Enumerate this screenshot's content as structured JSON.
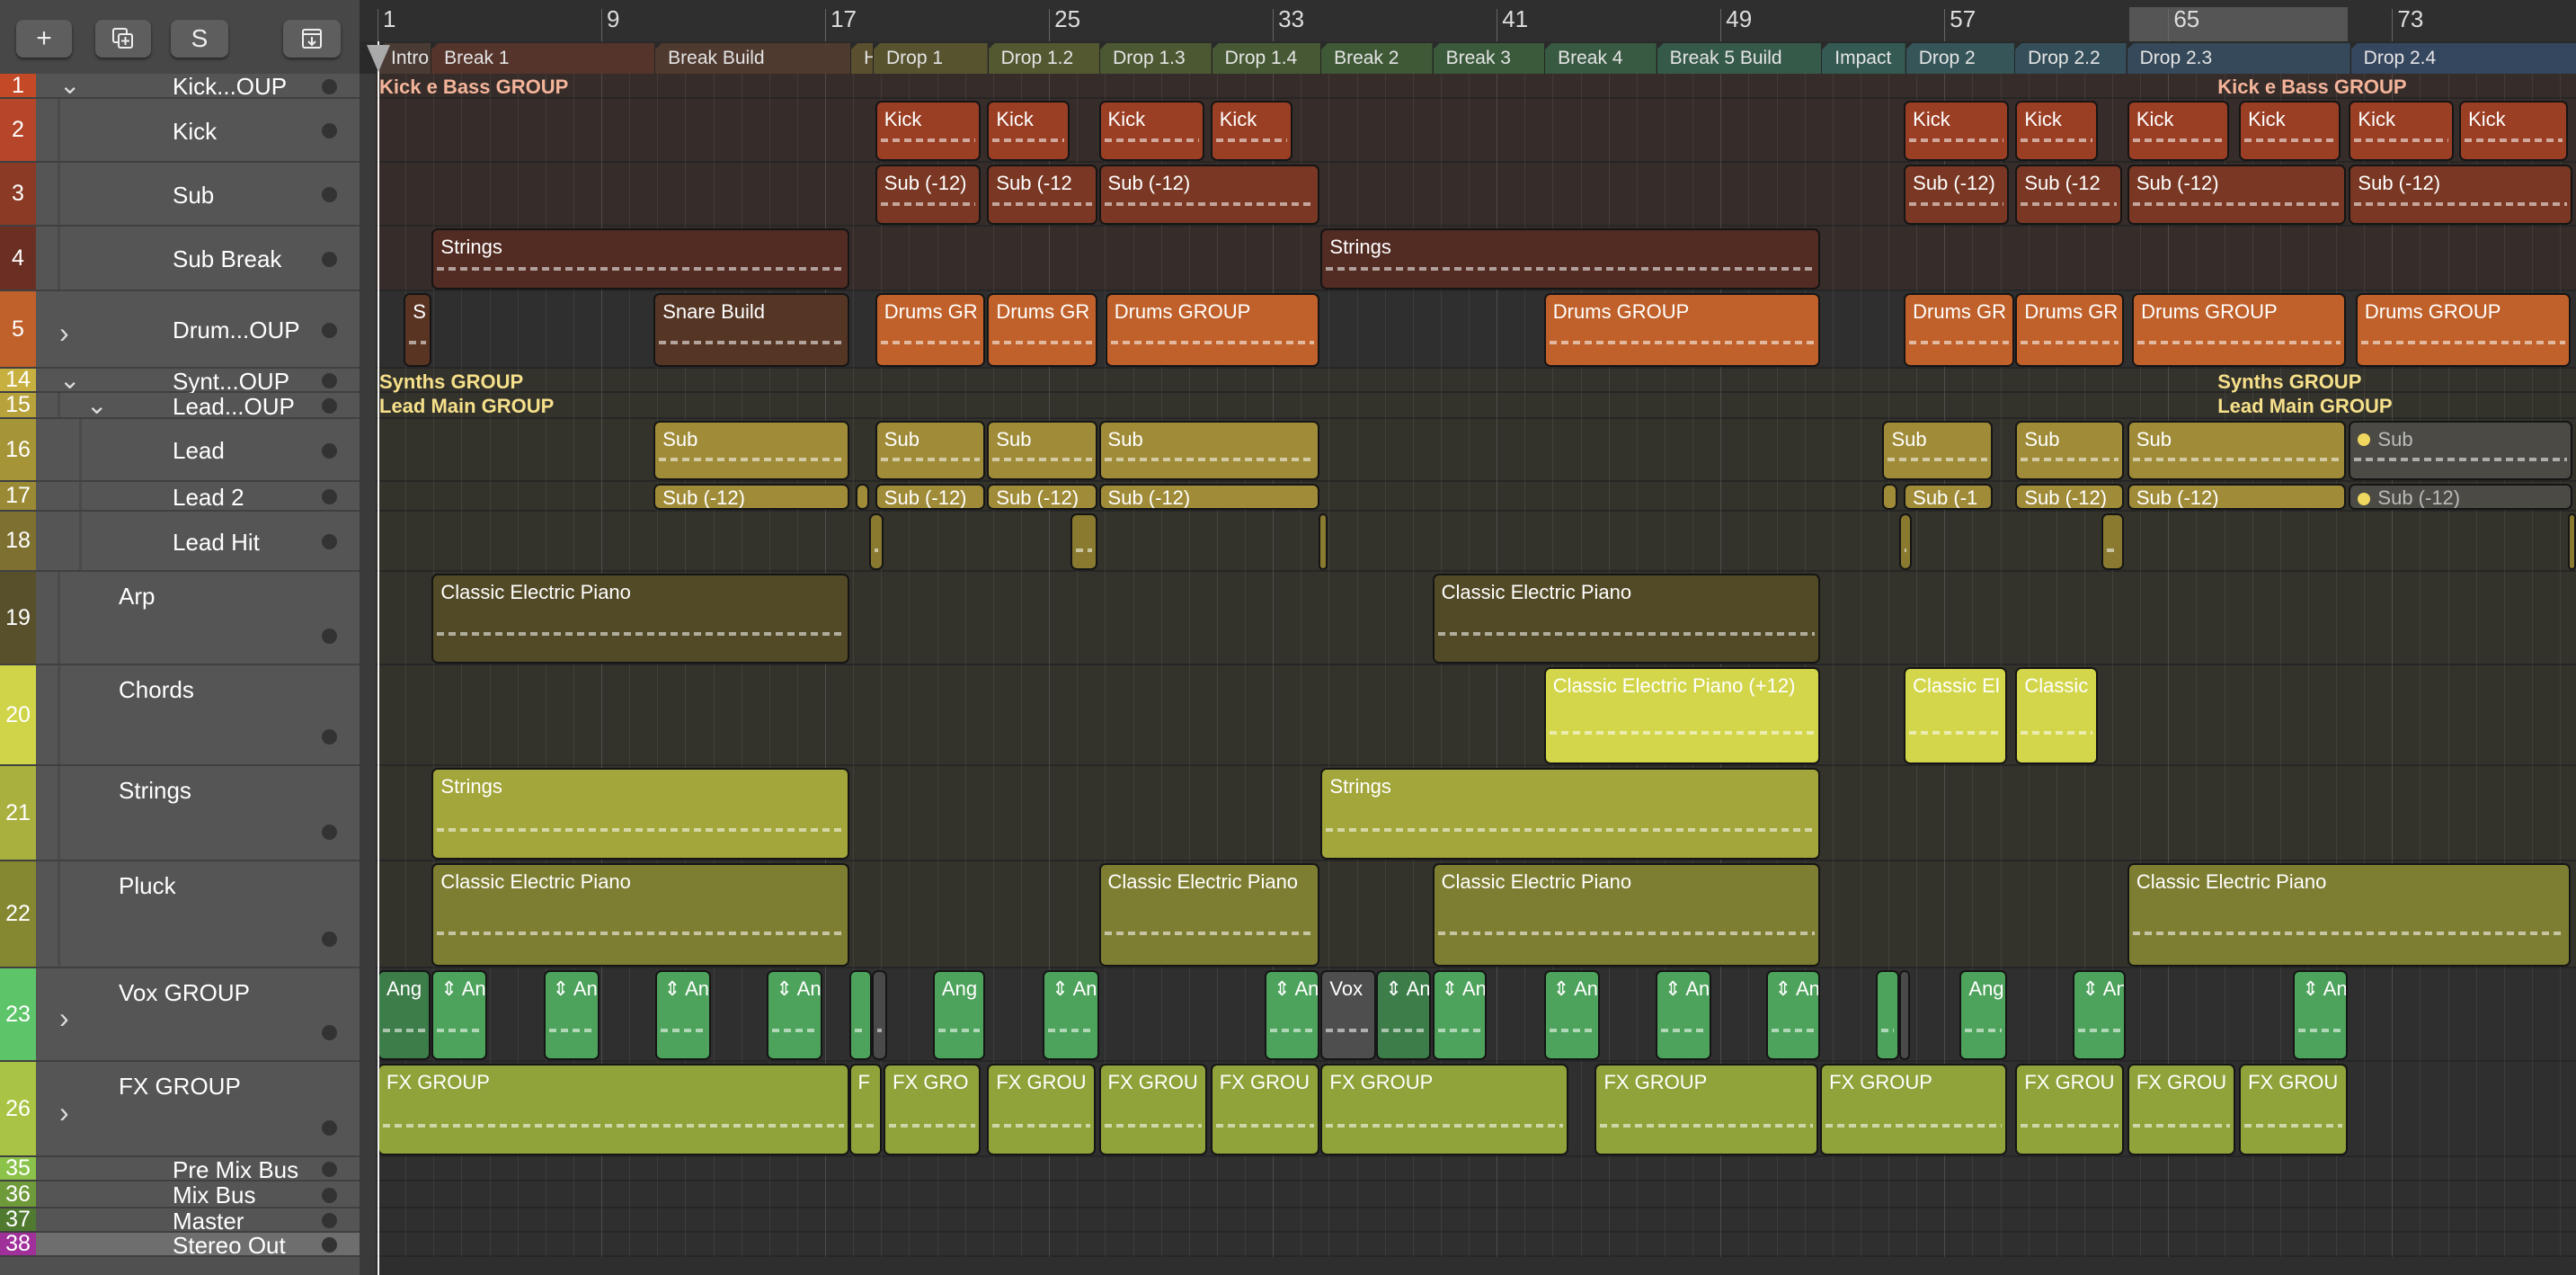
{
  "toolbar": {
    "add_label": "+",
    "duplicate_icon": "duplicate-track-icon",
    "s_label": "S",
    "download_icon": "download-icon"
  },
  "ruler": {
    "labels": [
      "1",
      "9",
      "17",
      "25",
      "33",
      "41",
      "49",
      "57",
      "65",
      "73"
    ],
    "bars": [
      1,
      9,
      17,
      25,
      33,
      41,
      49,
      57,
      65,
      73
    ],
    "cycle": {
      "start": 63.6,
      "end": 71.4
    }
  },
  "markers": [
    {
      "label": "Intro",
      "start": 1,
      "end": 2.9,
      "color": "#4a3b35"
    },
    {
      "label": "Break 1",
      "start": 2.9,
      "end": 10.9,
      "color": "#55342c"
    },
    {
      "label": "Break Build",
      "start": 10.9,
      "end": 17.9,
      "color": "#4f3a2f"
    },
    {
      "label": "H",
      "start": 17.9,
      "end": 18.7,
      "color": "#5a4f2e"
    },
    {
      "label": "Drop 1",
      "start": 18.7,
      "end": 22.8,
      "color": "#58532f"
    },
    {
      "label": "Drop 1.2",
      "start": 22.8,
      "end": 26.8,
      "color": "#535831"
    },
    {
      "label": "Drop 1.3",
      "start": 26.8,
      "end": 30.8,
      "color": "#4c5832"
    },
    {
      "label": "Drop 1.4",
      "start": 30.8,
      "end": 34.7,
      "color": "#465934"
    },
    {
      "label": "Break 2",
      "start": 34.7,
      "end": 38.7,
      "color": "#3f5936"
    },
    {
      "label": "Break 3",
      "start": 38.7,
      "end": 42.7,
      "color": "#3a5a3b"
    },
    {
      "label": "Break 4",
      "start": 42.7,
      "end": 46.7,
      "color": "#385a42"
    },
    {
      "label": "Break 5 Build",
      "start": 46.7,
      "end": 52.6,
      "color": "#365a4a"
    },
    {
      "label": "Impact",
      "start": 52.6,
      "end": 55.6,
      "color": "#355a53"
    },
    {
      "label": "Drop 2",
      "start": 55.6,
      "end": 59.5,
      "color": "#355559"
    },
    {
      "label": "Drop 2.2",
      "start": 59.5,
      "end": 63.5,
      "color": "#354f5a"
    },
    {
      "label": "Drop 2.3",
      "start": 63.5,
      "end": 71.5,
      "color": "#35495a"
    },
    {
      "label": "Drop 2.4",
      "start": 71.5,
      "end": 79.6,
      "color": "#35465f"
    }
  ],
  "tracks": [
    {
      "num": "1",
      "name": "Kick...OUP",
      "color": "#c44a27",
      "lane": "#362c29",
      "disclosure": "open",
      "group_label": "Kick e Bass GROUP",
      "group_color": "#f4b49a",
      "group_at": [
        1,
        66.7
      ],
      "regions": []
    },
    {
      "num": "2",
      "name": "Kick",
      "color": "#b5462a",
      "lane": "#362c29",
      "rcolor": "#9a3e24",
      "regions": [
        {
          "label": "Kick",
          "s": 18.79,
          "e": 22.55
        },
        {
          "label": "Kick",
          "s": 22.79,
          "e": 25.72
        },
        {
          "label": "Kick",
          "s": 26.78,
          "e": 30.54
        },
        {
          "label": "Kick",
          "s": 30.77,
          "e": 33.71
        },
        {
          "label": "Kick",
          "s": 55.55,
          "e": 59.31
        },
        {
          "label": "Kick",
          "s": 59.54,
          "e": 62.48
        },
        {
          "label": "Kick",
          "s": 63.54,
          "e": 67.18
        },
        {
          "label": "Kick",
          "s": 67.53,
          "e": 71.17
        },
        {
          "label": "Kick",
          "s": 71.46,
          "e": 75.22
        },
        {
          "label": "Kick",
          "s": 75.4,
          "e": 79.27
        }
      ]
    },
    {
      "num": "3",
      "name": "Sub",
      "color": "#8a3a25",
      "lane": "#362c29",
      "rcolor": "#7a3824",
      "regions": [
        {
          "label": "Sub (-12)",
          "s": 18.79,
          "e": 22.55
        },
        {
          "label": "Sub (-12",
          "s": 22.79,
          "e": 26.72
        },
        {
          "label": "Sub (-12)",
          "s": 26.78,
          "e": 34.65
        },
        {
          "label": "Sub (-12)",
          "s": 55.55,
          "e": 59.31
        },
        {
          "label": "Sub (-12",
          "s": 59.54,
          "e": 63.36
        },
        {
          "label": "Sub (-12)",
          "s": 63.54,
          "e": 71.35
        },
        {
          "label": "Sub (-12)",
          "s": 71.46,
          "e": 79.45
        }
      ]
    },
    {
      "num": "4",
      "name": "Sub Break",
      "color": "#6a2f22",
      "lane": "#362c29",
      "rcolor": "#522b22",
      "regions": [
        {
          "label": "Strings",
          "s": 2.94,
          "e": 17.85
        },
        {
          "label": "Strings",
          "s": 34.71,
          "e": 52.56
        }
      ]
    },
    {
      "num": "5",
      "name": "Drum...OUP",
      "color": "#c0612b",
      "lane": "#2f2f2f",
      "disclosure": "closed",
      "rcolor": "#c0612b",
      "regions": [
        {
          "label": "S",
          "s": 1.94,
          "e": 2.94,
          "c": "#5a3423"
        },
        {
          "label": "Snare Build",
          "s": 10.87,
          "e": 17.85,
          "c": "#553625"
        },
        {
          "label": "Drums GR",
          "s": 18.79,
          "e": 22.73
        },
        {
          "label": "Drums GR",
          "s": 22.79,
          "e": 26.72
        },
        {
          "label": "Drums GROUP",
          "s": 27.01,
          "e": 34.65
        },
        {
          "label": "Drums GROUP",
          "s": 42.69,
          "e": 52.56
        },
        {
          "label": "Drums GR",
          "s": 55.55,
          "e": 59.49
        },
        {
          "label": "Drums GR",
          "s": 59.54,
          "e": 63.42
        },
        {
          "label": "Drums GROUP",
          "s": 63.71,
          "e": 71.35
        },
        {
          "label": "Drums GROUP",
          "s": 71.7,
          "e": 79.39
        }
      ]
    },
    {
      "num": "14",
      "name": "Synt...OUP",
      "color": "#c8b040",
      "lane": "#33322b",
      "disclosure": "open",
      "group_label": "Synths GROUP",
      "group_color": "#f6e08a",
      "group_at": [
        1,
        66.7
      ],
      "regions": []
    },
    {
      "num": "15",
      "name": "Lead...OUP",
      "color": "#b8a23c",
      "lane": "#33322b",
      "disclosure": "open",
      "group_label": "Lead Main GROUP",
      "group_color": "#f6e08a",
      "group_at": [
        1,
        66.7
      ],
      "regions": []
    },
    {
      "num": "16",
      "name": "Lead",
      "color": "#a59537",
      "lane": "#33322b",
      "rcolor": "#a08c38",
      "regions": [
        {
          "label": "Sub",
          "s": 10.87,
          "e": 17.85
        },
        {
          "label": "Sub",
          "s": 18.79,
          "e": 22.73
        },
        {
          "label": "Sub",
          "s": 22.79,
          "e": 26.72
        },
        {
          "label": "Sub",
          "s": 26.78,
          "e": 34.65
        },
        {
          "label": "Sub",
          "s": 54.79,
          "e": 58.72
        },
        {
          "label": "Sub",
          "s": 59.54,
          "e": 63.42
        },
        {
          "label": "Sub",
          "s": 63.54,
          "e": 71.35
        },
        {
          "label": "Sub",
          "s": 71.46,
          "e": 79.45,
          "c": "#4b4a44",
          "muted": true
        }
      ]
    },
    {
      "num": "17",
      "name": "Lead 2",
      "color": "#9a8a35",
      "lane": "#33322b",
      "rcolor": "#a08c38",
      "regions": [
        {
          "label": "Sub (-12)",
          "s": 10.87,
          "e": 17.85
        },
        {
          "label": "",
          "s": 18.09,
          "e": 18.56
        },
        {
          "label": "Sub (-12)",
          "s": 18.79,
          "e": 22.73
        },
        {
          "label": "Sub (-12)",
          "s": 22.79,
          "e": 26.72
        },
        {
          "label": "Sub (-12)",
          "s": 26.78,
          "e": 34.65
        },
        {
          "label": "",
          "s": 54.79,
          "e": 55.32
        },
        {
          "label": "Sub (-1",
          "s": 55.55,
          "e": 58.72
        },
        {
          "label": "Sub (-12)",
          "s": 59.54,
          "e": 63.42
        },
        {
          "label": "Sub (-12)",
          "s": 63.54,
          "e": 71.35
        },
        {
          "label": "Sub (-12)",
          "s": 71.46,
          "e": 79.45,
          "c": "#4b4a44",
          "muted": true
        }
      ]
    },
    {
      "num": "18",
      "name": "Lead Hit",
      "color": "#7d7030",
      "lane": "#33322b",
      "rcolor": "#8a7a30",
      "regions": [
        {
          "label": "",
          "s": 18.56,
          "e": 19.09
        },
        {
          "label": "",
          "s": 25.78,
          "e": 26.72
        },
        {
          "label": "",
          "s": 34.63,
          "e": 34.94
        },
        {
          "label": "",
          "s": 55.38,
          "e": 55.84
        },
        {
          "label": "",
          "s": 62.6,
          "e": 63.42
        },
        {
          "label": "",
          "s": 79.27,
          "e": 79.57
        }
      ]
    },
    {
      "num": "19",
      "name": "Arp",
      "color": "#58502a",
      "lane": "#33322b",
      "big": true,
      "rcolor": "#524a26",
      "regions": [
        {
          "label": "Classic Electric Piano",
          "s": 2.94,
          "e": 17.85
        },
        {
          "label": "Classic Electric Piano",
          "s": 38.7,
          "e": 52.56
        }
      ]
    },
    {
      "num": "20",
      "name": "Chords",
      "color": "#cfd448",
      "lane": "#33322b",
      "big": true,
      "rcolor": "#d3d64a",
      "regions": [
        {
          "label": "Classic Electric Piano (+12)",
          "s": 42.69,
          "e": 52.56
        },
        {
          "label": "Classic El",
          "s": 55.55,
          "e": 59.25
        },
        {
          "label": "Classic",
          "s": 59.54,
          "e": 62.48
        }
      ]
    },
    {
      "num": "21",
      "name": "Strings",
      "color": "#aab03e",
      "lane": "#33322b",
      "big": true,
      "rcolor": "#a3a63a",
      "regions": [
        {
          "label": "Strings",
          "s": 2.94,
          "e": 17.85
        },
        {
          "label": "Strings",
          "s": 34.71,
          "e": 52.56
        }
      ]
    },
    {
      "num": "22",
      "name": "Pluck",
      "color": "#858830",
      "lane": "#33322b",
      "big": true,
      "rcolor": "#7e7e32",
      "regions": [
        {
          "label": "Classic Electric Piano",
          "s": 2.94,
          "e": 17.85
        },
        {
          "label": "Classic Electric Piano",
          "s": 26.78,
          "e": 34.65
        },
        {
          "label": "Classic Electric Piano",
          "s": 38.7,
          "e": 52.56
        },
        {
          "label": "Classic Electric Piano",
          "s": 63.54,
          "e": 79.39
        }
      ]
    },
    {
      "num": "23",
      "name": "Vox GROUP",
      "color": "#5ec46a",
      "lane": "#2f2f2f",
      "big": true,
      "disclosure": "closed",
      "rcolor": "#4ea35c",
      "regions": [
        {
          "label": "Ang",
          "s": 1,
          "e": 2.9,
          "c": "#3d7d4a"
        },
        {
          "label": "⇕ An",
          "s": 2.94,
          "e": 4.93
        },
        {
          "label": "⇕ An",
          "s": 6.93,
          "e": 8.93
        },
        {
          "label": "⇕ An",
          "s": 10.92,
          "e": 12.92
        },
        {
          "label": "⇕ An",
          "s": 14.92,
          "e": 16.91
        },
        {
          "label": "",
          "s": 17.85,
          "e": 18.67
        },
        {
          "label": "",
          "s": 18.67,
          "e": 19.2,
          "c": "#4a4a4a"
        },
        {
          "label": "Ang",
          "s": 20.85,
          "e": 22.73
        },
        {
          "label": "⇕ An",
          "s": 24.78,
          "e": 26.78
        },
        {
          "label": "⇕ An",
          "s": 32.71,
          "e": 34.65
        },
        {
          "label": "Vox",
          "s": 34.71,
          "e": 36.7,
          "c": "#4e4e4e"
        },
        {
          "label": "⇕ An",
          "s": 36.7,
          "e": 38.64,
          "c": "#3d7d4a"
        },
        {
          "label": "⇕ An",
          "s": 38.7,
          "e": 40.64
        },
        {
          "label": "⇕ An",
          "s": 42.69,
          "e": 44.69
        },
        {
          "label": "⇕ An",
          "s": 46.68,
          "e": 48.68
        },
        {
          "label": "⇕ An",
          "s": 50.62,
          "e": 52.56
        },
        {
          "label": "",
          "s": 54.55,
          "e": 55.38
        },
        {
          "label": "",
          "s": 55.38,
          "e": 55.78,
          "c": "#4a4a4a"
        },
        {
          "label": "Ang",
          "s": 57.55,
          "e": 59.25
        },
        {
          "label": "⇕ An",
          "s": 61.6,
          "e": 63.48
        },
        {
          "label": "⇕ An",
          "s": 69.47,
          "e": 71.4
        }
      ]
    },
    {
      "num": "26",
      "name": "FX GROUP",
      "color": "#a9c444",
      "lane": "#2f2f2f",
      "big": true,
      "disclosure": "closed",
      "rcolor": "#8fa33a",
      "regions": [
        {
          "label": "FX GROUP",
          "s": 1,
          "e": 17.85
        },
        {
          "label": "F",
          "s": 17.85,
          "e": 19.03
        },
        {
          "label": "FX GRO",
          "s": 19.09,
          "e": 22.55
        },
        {
          "label": "FX GROU",
          "s": 22.79,
          "e": 26.66
        },
        {
          "label": "FX GROU",
          "s": 26.78,
          "e": 30.65
        },
        {
          "label": "FX GROU",
          "s": 30.77,
          "e": 34.65
        },
        {
          "label": "FX GROUP",
          "s": 34.71,
          "e": 43.57
        },
        {
          "label": "FX GROUP",
          "s": 44.51,
          "e": 52.5
        },
        {
          "label": "FX GROUP",
          "s": 52.56,
          "e": 59.25
        },
        {
          "label": "FX GROU",
          "s": 59.54,
          "e": 63.42
        },
        {
          "label": "FX GROU",
          "s": 63.54,
          "e": 67.41
        },
        {
          "label": "FX GROU",
          "s": 67.53,
          "e": 71.4
        }
      ]
    },
    {
      "num": "35",
      "name": "Pre Mix Bus",
      "color": "#8bc34a",
      "lane": "#2f2f2f",
      "regions": []
    },
    {
      "num": "36",
      "name": "Mix Bus",
      "color": "#6f9a3a",
      "lane": "#2f2f2f",
      "regions": []
    },
    {
      "num": "37",
      "name": "Master",
      "color": "#4f7a30",
      "lane": "#2f2f2f",
      "regions": []
    },
    {
      "num": "38",
      "name": "Stereo Out",
      "color": "#a0309a",
      "lane": "#2f2f2f",
      "selected": true,
      "regions": []
    }
  ]
}
